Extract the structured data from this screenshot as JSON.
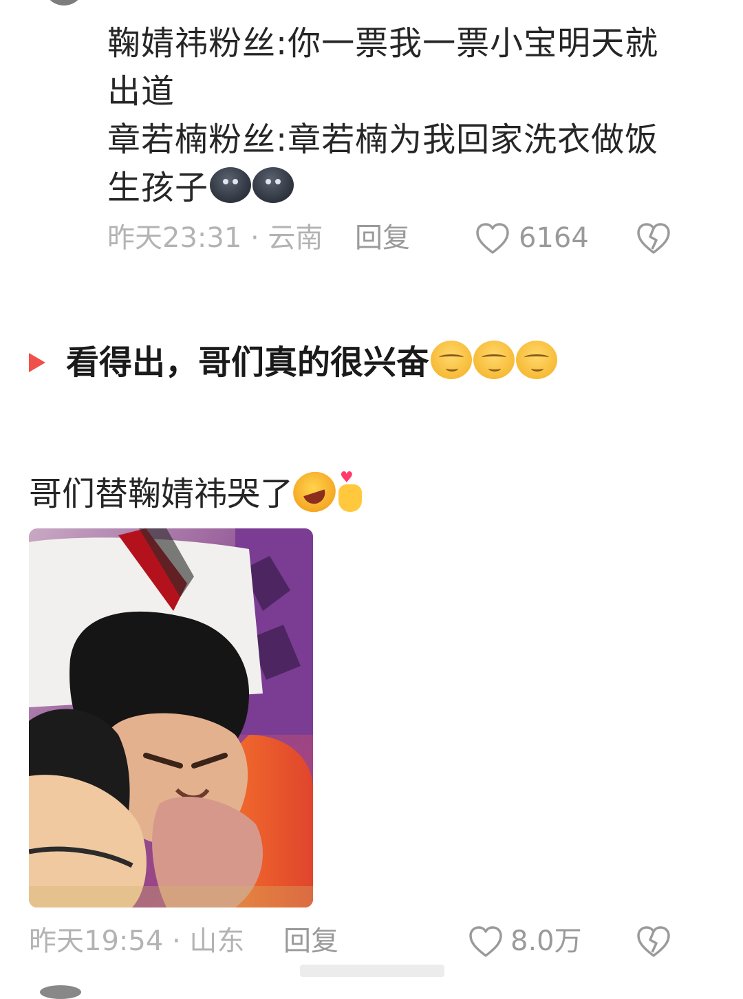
{
  "comment1": {
    "lines": [
      "鞠婧祎粉丝:你一票我一票小宝明天就",
      "出道",
      "章若楠粉丝:章若楠为我回家洗衣做饭",
      "生孩子"
    ],
    "emoji": "dark-face-emoji",
    "time": "昨天23:31 · 云南",
    "reply_label": "回复",
    "likes": "6164"
  },
  "section": {
    "title": "看得出，哥们真的很兴奋",
    "emoji": "smirk-emoji"
  },
  "comment2": {
    "text": "哥们替鞠婧祎哭了",
    "emojis": [
      "rofl-emoji",
      "finger-heart-emoji"
    ],
    "image": "photo-crying-man",
    "time": "昨天19:54 · 山东",
    "reply_label": "回复",
    "likes": "8.0万"
  },
  "colors": {
    "accent_play": "#f0504a",
    "meta_text": "#b3b3b3",
    "body_text": "#262626"
  }
}
